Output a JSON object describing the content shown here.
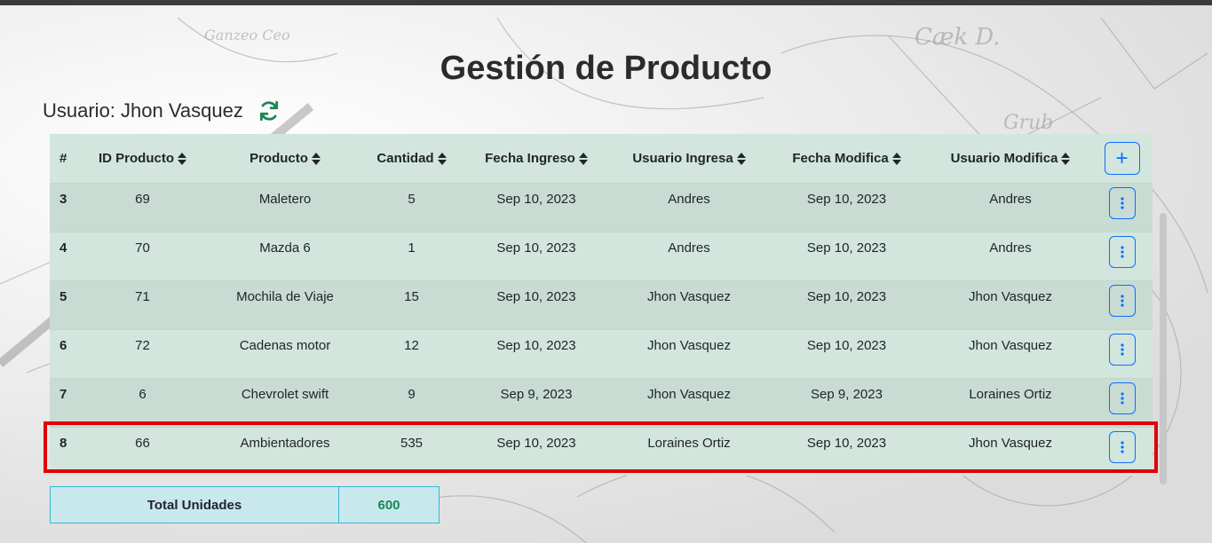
{
  "page": {
    "title": "Gestión de Producto"
  },
  "user": {
    "label": "Usuario: Jhon Vasquez"
  },
  "table": {
    "headers": [
      "#",
      "ID Producto",
      "Producto",
      "Cantidad",
      "Fecha Ingreso",
      "Usuario Ingresa",
      "Fecha Modifica",
      "Usuario Modifica"
    ],
    "add_label": "+",
    "rows": [
      {
        "num": "3",
        "id": "69",
        "producto": "Maletero",
        "cantidad": "5",
        "fecha_ingreso": "Sep 10, 2023",
        "usuario_ingresa": "Andres",
        "fecha_modifica": "Sep 10, 2023",
        "usuario_modifica": "Andres"
      },
      {
        "num": "4",
        "id": "70",
        "producto": "Mazda 6",
        "cantidad": "1",
        "fecha_ingreso": "Sep 10, 2023",
        "usuario_ingresa": "Andres",
        "fecha_modifica": "Sep 10, 2023",
        "usuario_modifica": "Andres"
      },
      {
        "num": "5",
        "id": "71",
        "producto": "Mochila de Viaje",
        "cantidad": "15",
        "fecha_ingreso": "Sep 10, 2023",
        "usuario_ingresa": "Jhon Vasquez",
        "fecha_modifica": "Sep 10, 2023",
        "usuario_modifica": "Jhon Vasquez"
      },
      {
        "num": "6",
        "id": "72",
        "producto": "Cadenas motor",
        "cantidad": "12",
        "fecha_ingreso": "Sep 10, 2023",
        "usuario_ingresa": "Jhon Vasquez",
        "fecha_modifica": "Sep 10, 2023",
        "usuario_modifica": "Jhon Vasquez"
      },
      {
        "num": "7",
        "id": "6",
        "producto": "Chevrolet swift",
        "cantidad": "9",
        "fecha_ingreso": "Sep 9, 2023",
        "usuario_ingresa": "Jhon Vasquez",
        "fecha_modifica": "Sep 9, 2023",
        "usuario_modifica": "Loraines Ortiz"
      },
      {
        "num": "8",
        "id": "66",
        "producto": "Ambientadores",
        "cantidad": "535",
        "fecha_ingreso": "Sep 10, 2023",
        "usuario_ingresa": "Loraines Ortiz",
        "fecha_modifica": "Sep 10, 2023",
        "usuario_modifica": "Jhon Vasquez"
      }
    ]
  },
  "total": {
    "label": "Total Unidades",
    "value": "600"
  },
  "colors": {
    "accent": "#0d6efd",
    "success": "#198754",
    "highlight": "#e00000",
    "table_bg": "#d2e6de"
  },
  "icons": {
    "refresh": "refresh-icon",
    "sort": "sort-icon",
    "add": "plus-icon",
    "menu": "vertical-dots-icon"
  }
}
